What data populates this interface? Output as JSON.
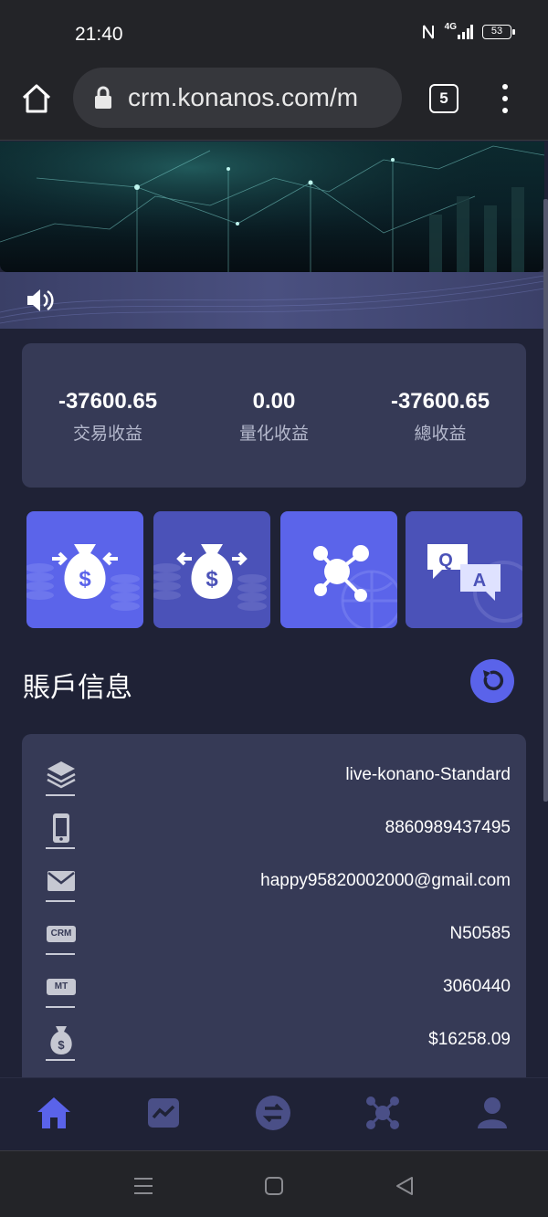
{
  "status_bar": {
    "time": "21:40",
    "network": "4G",
    "battery": "53"
  },
  "browser": {
    "url": "crm.konanos.com/m",
    "tab_count": "5"
  },
  "stats": [
    {
      "value": "-37600.65",
      "label": "交易收益"
    },
    {
      "value": "0.00",
      "label": "量化收益"
    },
    {
      "value": "-37600.65",
      "label": "總收益"
    }
  ],
  "actions": [
    {
      "icon": "deposit-money-bag-icon",
      "color": "#5b64ea"
    },
    {
      "icon": "withdraw-money-bag-icon",
      "color": "#4b52b8"
    },
    {
      "icon": "network-nodes-icon",
      "color": "#5b64ea"
    },
    {
      "icon": "qa-chat-icon",
      "color": "#4b52b8"
    }
  ],
  "account": {
    "title": "賬戶信息",
    "rows": [
      {
        "icon": "layers-icon",
        "value": "live-konano-Standard"
      },
      {
        "icon": "phone-icon",
        "value": "8860989437495"
      },
      {
        "icon": "mail-icon",
        "value": "happy95820002000@gmail.com"
      },
      {
        "icon": "crm-tag-icon",
        "tag": "CRM",
        "value": "N50585"
      },
      {
        "icon": "mt-tag-icon",
        "tag": "MT",
        "value": "3060440"
      },
      {
        "icon": "money-bag-icon",
        "value": "$16258.09"
      }
    ]
  },
  "bottom_nav": [
    {
      "icon": "home-icon",
      "active": true
    },
    {
      "icon": "chart-icon",
      "active": false
    },
    {
      "icon": "transfer-icon",
      "active": false
    },
    {
      "icon": "network-icon",
      "active": false
    },
    {
      "icon": "user-icon",
      "active": false
    }
  ],
  "colors": {
    "accent": "#5a63ea",
    "background": "#1f2236",
    "card": "#363a56"
  }
}
